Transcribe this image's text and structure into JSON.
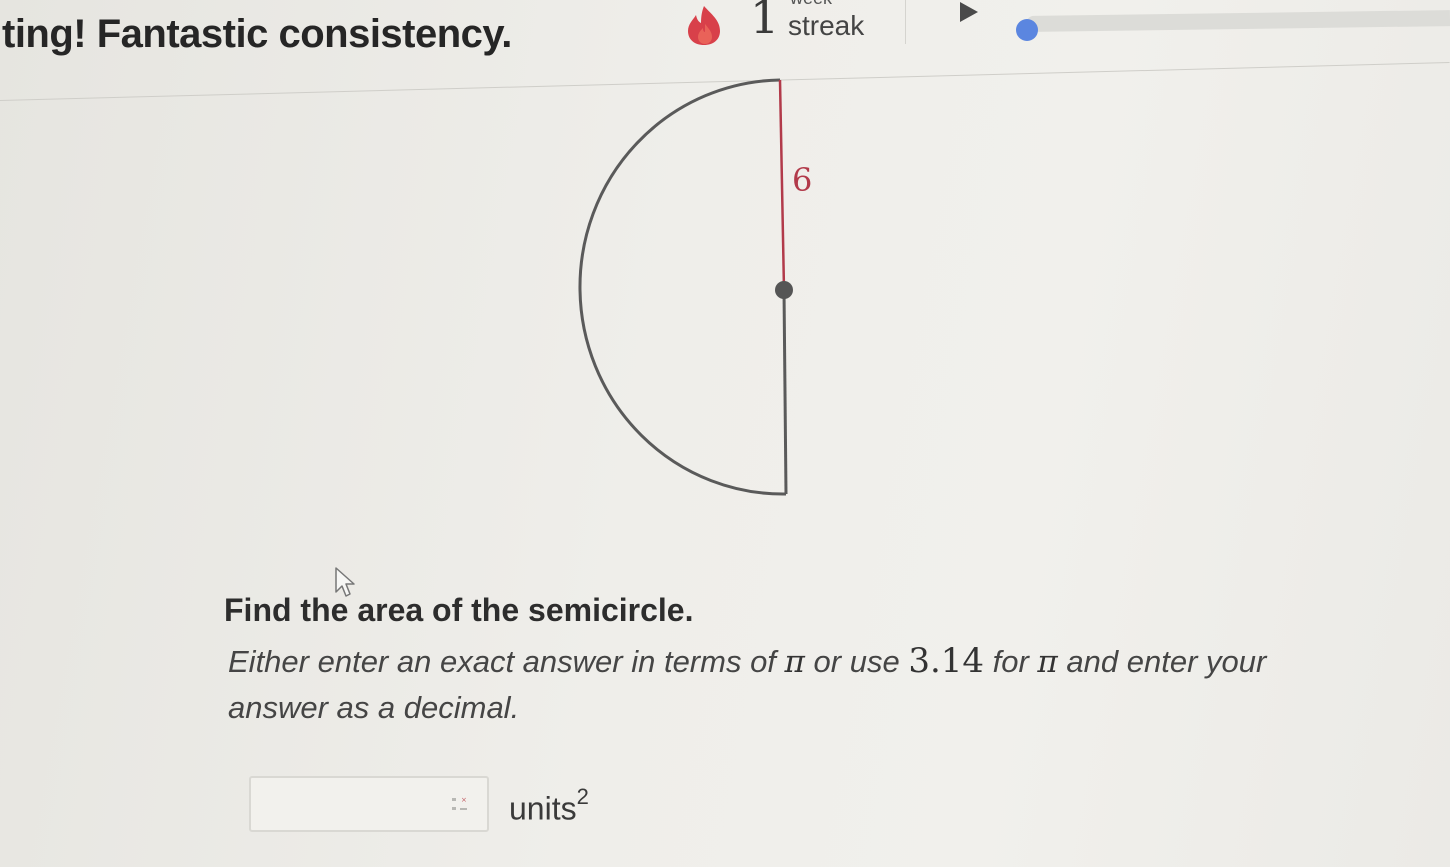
{
  "banner": {
    "message": "ting! Fantastic consistency.",
    "streak": {
      "count": "1",
      "unit": "week",
      "label": "streak"
    }
  },
  "diagram": {
    "label": "6"
  },
  "question": {
    "prompt": "Find the area of the semicircle.",
    "instructions": {
      "part1": "Either enter an exact answer in terms of ",
      "pi1": "π",
      "part2": " or use ",
      "value": "3.14",
      "part3": " for ",
      "pi2": "π",
      "part4": " and enter your answer as a decimal."
    }
  },
  "answer": {
    "value": "",
    "units": "units",
    "exponent": "2"
  },
  "colors": {
    "label": "#b23a4a",
    "arc": "#5a5a5a",
    "progress_dot": "#5b86e0",
    "flame": "#d8404a"
  }
}
